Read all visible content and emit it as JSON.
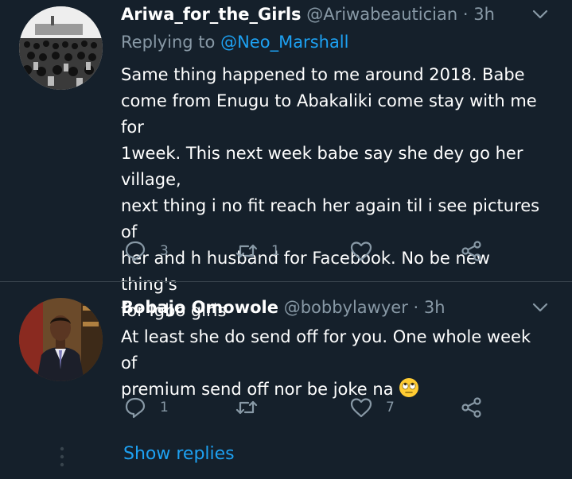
{
  "colors": {
    "background": "#15202b",
    "text": "#ffffff",
    "muted": "#8899a6",
    "link": "#1da1f2",
    "divider": "#38444d"
  },
  "tweets": [
    {
      "name": "Ariwa_for_the_Girls",
      "handle": "@Ariwabeautician",
      "dot": "·",
      "time": "3h",
      "replying_prefix": "Replying to",
      "replying_to": "@Neo_Marshall",
      "text": "Same thing happened to me around 2018.  Babe\ncome from Enugu to Abakaliki come stay with me for\n1week. This next week babe say she dey go her village,\nnext thing i no fit reach her again  til i see pictures of\nher and h husband for Facebook. No be new thing's\nfor Igbo girls",
      "reply_count": "3",
      "retweet_count": "1",
      "like_count": "",
      "avatar_icon": "crowd-photo",
      "icons": {
        "reply": "reply-icon",
        "retweet": "retweet-icon",
        "like": "heart-icon",
        "share": "share-icon",
        "menu": "chevron-down-icon"
      }
    },
    {
      "name": "Bobajo Omowole",
      "handle": "@bobbylawyer",
      "dot": "·",
      "time": "3h",
      "text": "At least she do send off for you. One whole week of\npremium send off nor be joke na",
      "emoji": "face-with-rolling-eyes",
      "reply_count": "1",
      "retweet_count": "",
      "like_count": "7",
      "avatar_icon": "man-in-suit-photo",
      "icons": {
        "reply": "reply-icon",
        "retweet": "retweet-icon",
        "like": "heart-icon",
        "share": "share-icon",
        "menu": "chevron-down-icon"
      }
    }
  ],
  "show_replies": "Show replies"
}
